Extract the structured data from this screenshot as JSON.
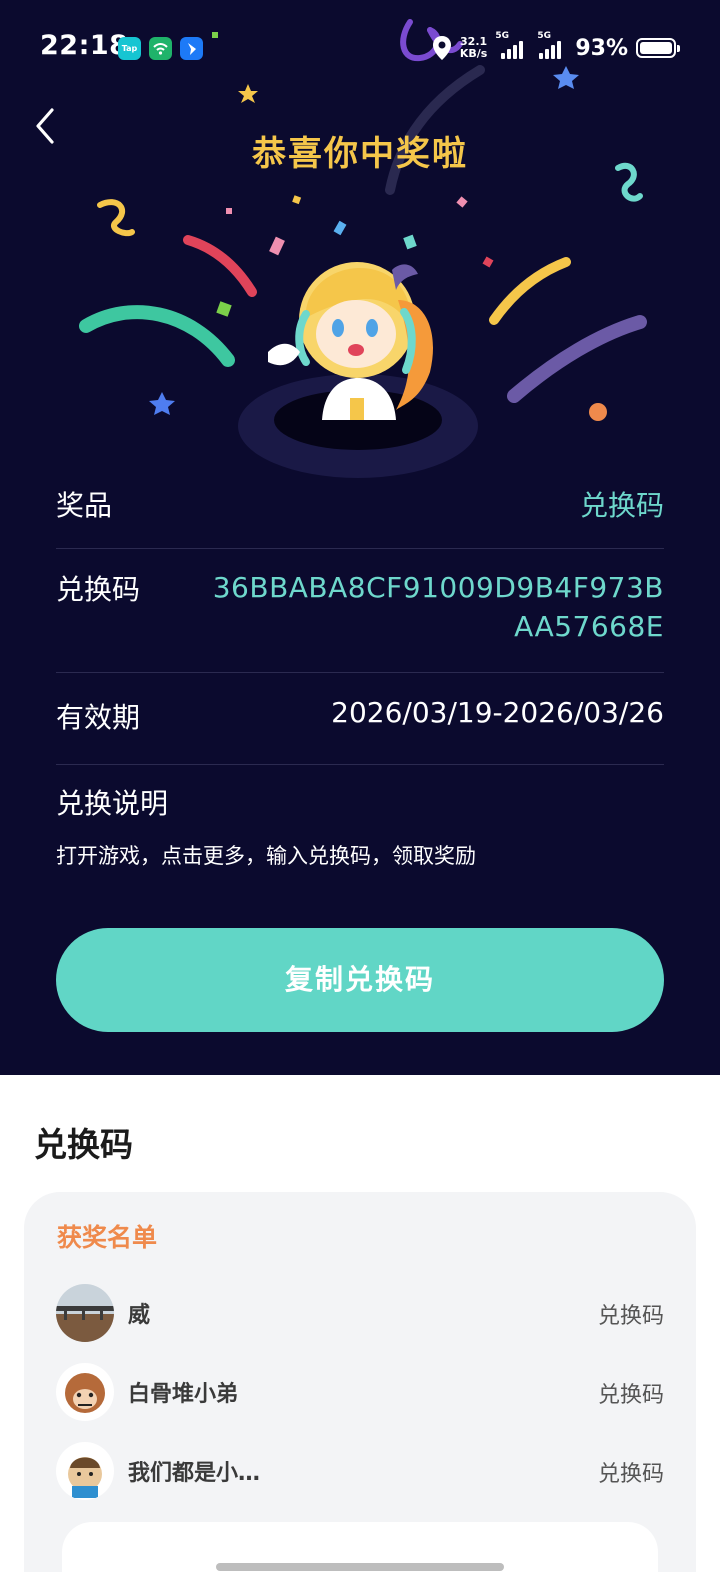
{
  "status_bar": {
    "time": "22:18",
    "net_speed_value": "32.1",
    "net_speed_unit": "KB/s",
    "sim1": "5G",
    "sim2": "5G",
    "battery": "93%",
    "app_icons": [
      "taptap-icon",
      "wifi-app-icon",
      "feishu-icon"
    ]
  },
  "header": {
    "title": "恭喜你中奖啦"
  },
  "details": {
    "prize_label": "奖品",
    "prize_value": "兑换码",
    "code_label": "兑换码",
    "code_value": "36BBABA8CF91009D9B4F973BAA57668E",
    "validity_label": "有效期",
    "validity_value": "2026/03/19-2026/03/26",
    "instructions_title": "兑换说明",
    "instructions_text": "打开游戏，点击更多，输入兑换码，领取奖励"
  },
  "copy_button_label": "复制兑换码",
  "sheet": {
    "title": "兑换码",
    "list_title": "获奖名单",
    "winners": [
      {
        "name": "威",
        "prize": "兑换码"
      },
      {
        "name": "白骨堆小弟",
        "prize": "兑换码"
      },
      {
        "name": "我们都是小…",
        "prize": "兑换码"
      }
    ]
  },
  "colors": {
    "background_dark": "#0b0a2e",
    "title_gold": "#f5c64a",
    "accent_teal": "#61d6c6",
    "list_title_orange": "#ef8a4c"
  }
}
